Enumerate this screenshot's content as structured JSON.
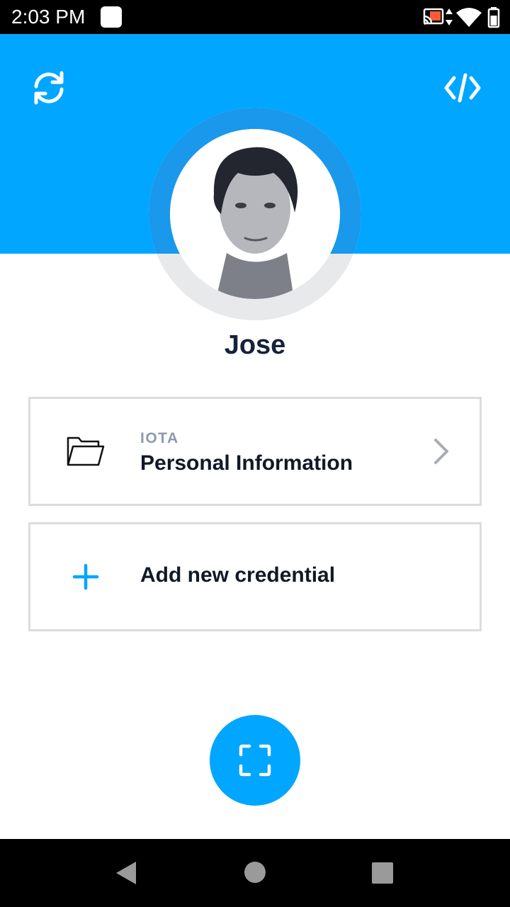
{
  "status_bar": {
    "time": "2:03 PM",
    "icons": [
      "cast-icon",
      "data-arrows-icon",
      "wifi-icon",
      "battery-icon"
    ]
  },
  "header": {
    "left_icon": "sync-icon",
    "right_icon": "code-icon",
    "accent_color": "#00a6ff"
  },
  "profile": {
    "name": "Jose"
  },
  "credentials": [
    {
      "issuer": "IOTA",
      "title": "Personal Information",
      "icon": "folder-icon"
    }
  ],
  "add_credential": {
    "label": "Add new credential",
    "icon": "plus-icon"
  },
  "fab": {
    "icon": "scan-icon"
  },
  "nav_bar": {
    "buttons": [
      "back-icon",
      "home-icon",
      "recents-icon"
    ]
  }
}
